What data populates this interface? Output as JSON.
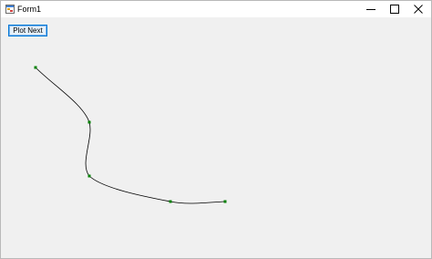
{
  "window": {
    "title": "Form1"
  },
  "toolbar": {
    "plot_next_label": "Plot Next"
  },
  "colors": {
    "curve": "#000000",
    "point": "#008000",
    "client_bg": "#f0f0f0"
  },
  "icons": [
    "form-app-icon",
    "minimize-icon",
    "maximize-icon",
    "close-icon"
  ]
}
